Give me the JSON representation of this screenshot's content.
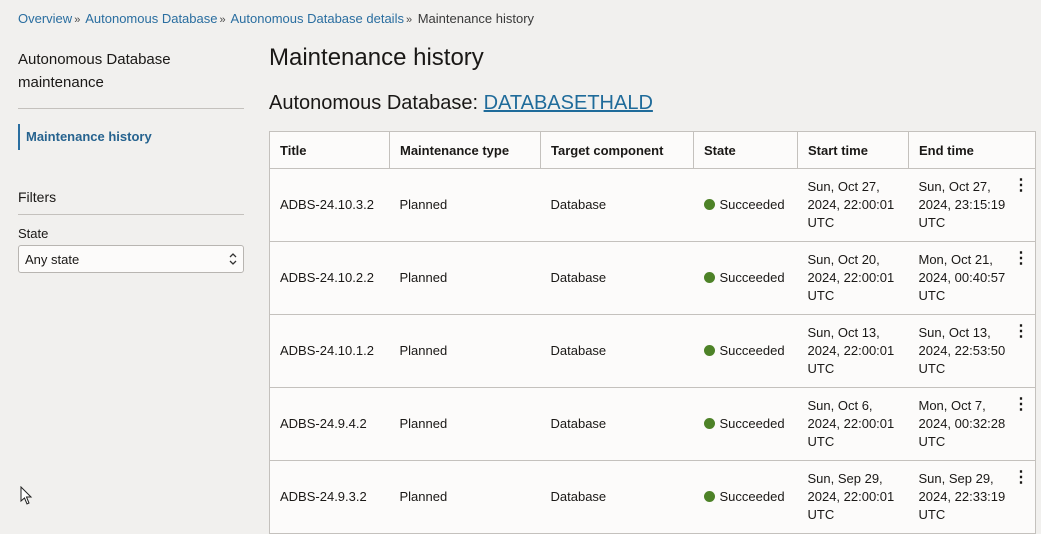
{
  "breadcrumb": {
    "items": [
      "Overview",
      "Autonomous Database",
      "Autonomous Database details"
    ],
    "current": "Maintenance history",
    "separator": "»"
  },
  "sidebar": {
    "title": "Autonomous Database maintenance",
    "nav_items": [
      {
        "label": "Maintenance history",
        "active": true
      }
    ],
    "filters_title": "Filters",
    "state_label": "State",
    "state_value": "Any state"
  },
  "main": {
    "title": "Maintenance history",
    "subtitle_prefix": "Autonomous Database:",
    "database_name": "DATABASETHALD"
  },
  "table": {
    "columns": [
      "Title",
      "Maintenance type",
      "Target component",
      "State",
      "Start time",
      "End time"
    ],
    "rows": [
      {
        "title": "ADBS-24.10.3.2",
        "type": "Planned",
        "target": "Database",
        "state": "Succeeded",
        "start": "Sun, Oct 27, 2024, 22:00:01 UTC",
        "end": "Sun, Oct 27, 2024, 23:15:19 UTC"
      },
      {
        "title": "ADBS-24.10.2.2",
        "type": "Planned",
        "target": "Database",
        "state": "Succeeded",
        "start": "Sun, Oct 20, 2024, 22:00:01 UTC",
        "end": "Mon, Oct 21, 2024, 00:40:57 UTC"
      },
      {
        "title": "ADBS-24.10.1.2",
        "type": "Planned",
        "target": "Database",
        "state": "Succeeded",
        "start": "Sun, Oct 13, 2024, 22:00:01 UTC",
        "end": "Sun, Oct 13, 2024, 22:53:50 UTC"
      },
      {
        "title": "ADBS-24.9.4.2",
        "type": "Planned",
        "target": "Database",
        "state": "Succeeded",
        "start": "Sun, Oct 6, 2024, 22:00:01 UTC",
        "end": "Mon, Oct 7, 2024, 00:32:28 UTC"
      },
      {
        "title": "ADBS-24.9.3.2",
        "type": "Planned",
        "target": "Database",
        "state": "Succeeded",
        "start": "Sun, Sep 29, 2024, 22:00:01 UTC",
        "end": "Sun, Sep 29, 2024, 22:33:19 UTC"
      }
    ]
  },
  "colors": {
    "success": "#4d8227",
    "link": "#2a6ea0"
  }
}
